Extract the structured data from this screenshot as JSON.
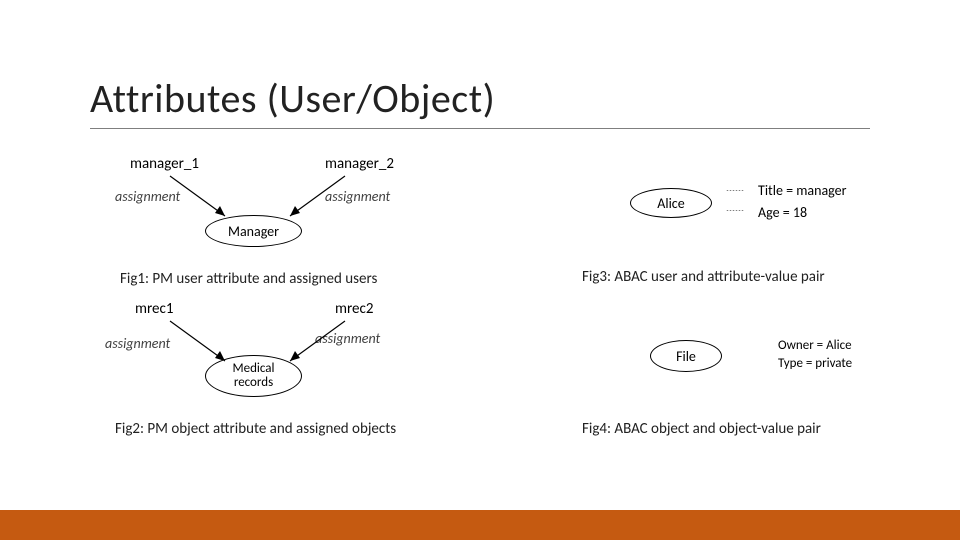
{
  "title": "Attributes (User/Object)",
  "fig1": {
    "top_left": "manager_1",
    "top_right": "manager_2",
    "edge_label_left": "assignment",
    "edge_label_right": "assignment",
    "bottom_node": "Manager",
    "caption": "Fig1: PM user attribute and assigned users"
  },
  "fig2": {
    "top_left": "mrec1",
    "top_right": "mrec2",
    "edge_label_left": "assignment",
    "edge_label_right": "assignment",
    "bottom_node": "Medical\nrecords",
    "caption": "Fig2: PM object attribute and assigned objects"
  },
  "fig3": {
    "node": "Alice",
    "attr1": "Title = manager",
    "attr2": "Age = 18",
    "caption": "Fig3: ABAC user and attribute-value pair"
  },
  "fig4": {
    "node": "File",
    "attr1": "Owner = Alice",
    "attr2": "Type = private",
    "caption": "Fig4: ABAC object and object-value pair"
  }
}
